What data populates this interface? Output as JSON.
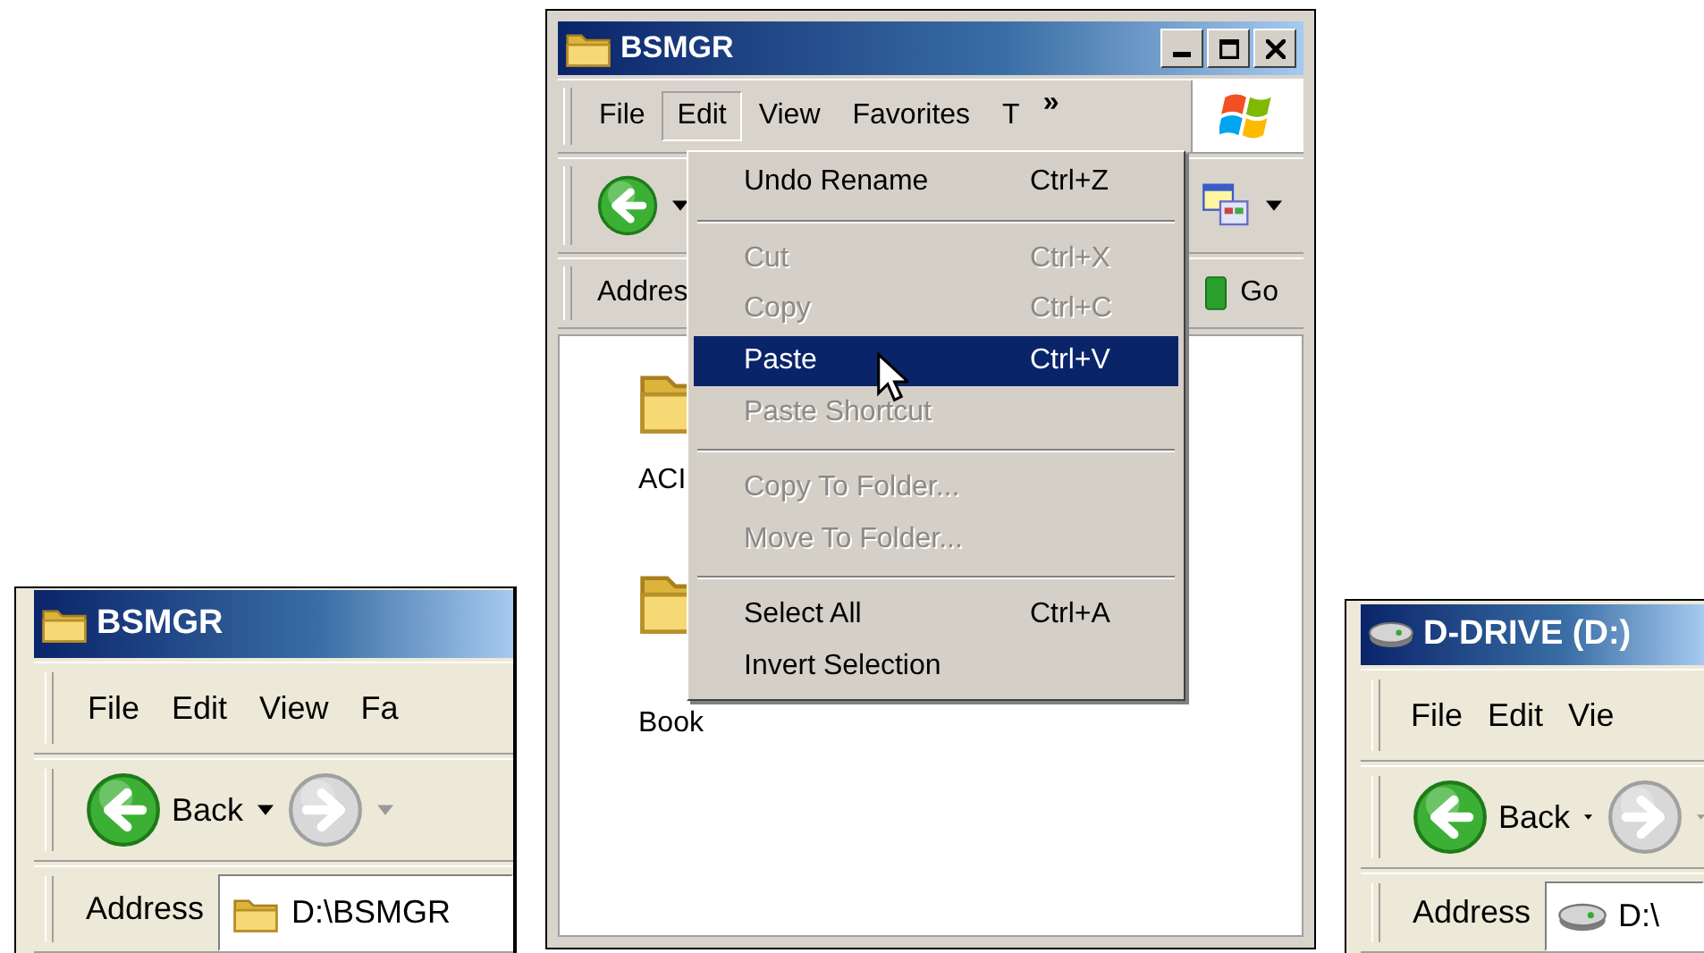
{
  "windows": [
    {
      "kind": "folder",
      "title": "BSMGR",
      "menus": [
        {
          "label": "File",
          "selected": false
        },
        {
          "label": "Edit",
          "selected": false
        },
        {
          "label": "View",
          "selected": false
        },
        {
          "label": "Fa",
          "selected": false
        }
      ],
      "toolbar": [
        {
          "kind": "back",
          "label": "Back"
        },
        {
          "kind": "forward"
        }
      ],
      "address": {
        "label": "Address",
        "value": "D:\\BSMGR"
      }
    },
    {
      "kind": "folder",
      "title": "BSMGR",
      "window_buttons": true,
      "menus": [
        {
          "label": "File",
          "selected": false
        },
        {
          "label": "Edit",
          "selected": true
        },
        {
          "label": "View",
          "selected": false
        },
        {
          "label": "Favorites",
          "selected": false
        },
        {
          "label": "T",
          "selected": false
        }
      ],
      "menu_more": "»",
      "brand_logo": true,
      "toolbar": [
        {
          "kind": "back"
        },
        {
          "kind": "views"
        }
      ],
      "address": {
        "label": "Addres",
        "go": "Go"
      },
      "folders": [
        {
          "name": "ACI"
        },
        {
          "name": "Book"
        }
      ],
      "menu": [
        {
          "kind": "item",
          "label": "Undo Rename",
          "shortcut": "Ctrl+Z",
          "disabled": false,
          "selected": false
        },
        {
          "kind": "separator"
        },
        {
          "kind": "item",
          "label": "Cut",
          "shortcut": "Ctrl+X",
          "disabled": true,
          "selected": false
        },
        {
          "kind": "item",
          "label": "Copy",
          "shortcut": "Ctrl+C",
          "disabled": true,
          "selected": false
        },
        {
          "kind": "item",
          "label": "Paste",
          "shortcut": "Ctrl+V",
          "disabled": false,
          "selected": true
        },
        {
          "kind": "item",
          "label": "Paste Shortcut",
          "disabled": true,
          "selected": false
        },
        {
          "kind": "separator"
        },
        {
          "kind": "item",
          "label": "Copy To Folder...",
          "disabled": true,
          "selected": false
        },
        {
          "kind": "item",
          "label": "Move To Folder...",
          "disabled": true,
          "selected": false
        },
        {
          "kind": "separator"
        },
        {
          "kind": "item",
          "label": "Select All",
          "shortcut": "Ctrl+A",
          "disabled": false,
          "selected": false
        },
        {
          "kind": "item",
          "label": "Invert Selection",
          "disabled": false,
          "selected": false
        }
      ]
    },
    {
      "kind": "drive",
      "title": "D-DRIVE (D:)",
      "menus": [
        {
          "label": "File",
          "selected": false
        },
        {
          "label": "Edit",
          "selected": false
        },
        {
          "label": "Vie",
          "selected": false
        }
      ],
      "toolbar": [
        {
          "kind": "back",
          "label": "Back"
        },
        {
          "kind": "forward"
        }
      ],
      "address": {
        "label": "Address",
        "value": "D:\\"
      }
    }
  ]
}
